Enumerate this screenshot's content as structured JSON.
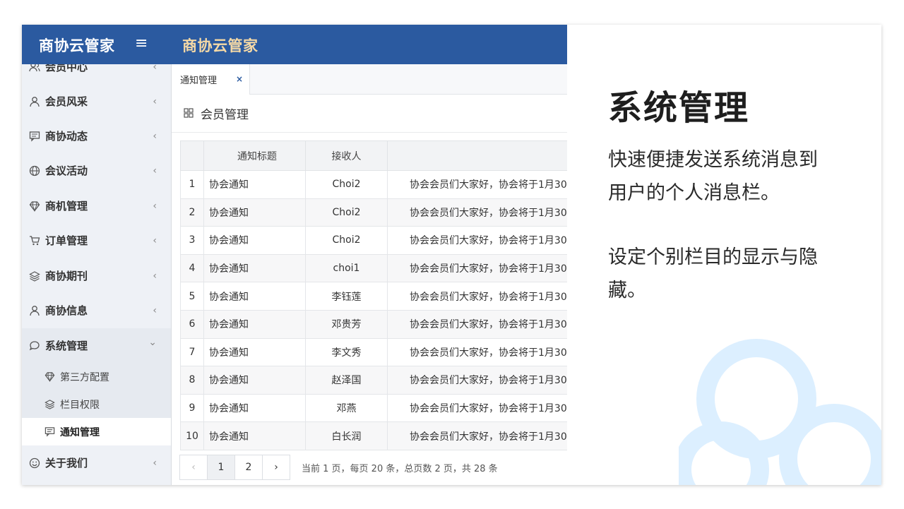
{
  "header": {
    "brand": "商协云管家",
    "menu_icon": "hamburger-icon",
    "title": "商协云管家"
  },
  "sidebar": {
    "items": [
      {
        "label": "会员中心",
        "icon": "user-group-icon"
      },
      {
        "label": "会员风采",
        "icon": "user-icon"
      },
      {
        "label": "商协动态",
        "icon": "message-icon"
      },
      {
        "label": "会议活动",
        "icon": "globe-icon"
      },
      {
        "label": "商机管理",
        "icon": "diamond-icon"
      },
      {
        "label": "订单管理",
        "icon": "cart-icon"
      },
      {
        "label": "商协期刊",
        "icon": "layers-icon"
      },
      {
        "label": "商协信息",
        "icon": "user-icon"
      },
      {
        "label": "系统管理",
        "icon": "chat-icon"
      },
      {
        "label": "关于我们",
        "icon": "smile-icon"
      }
    ],
    "subitems": [
      {
        "label": "第三方配置",
        "icon": "diamond-icon"
      },
      {
        "label": "栏目权限",
        "icon": "layers-icon"
      },
      {
        "label": "通知管理",
        "icon": "message-icon"
      }
    ],
    "chevron_collapsed": "‹",
    "chevron_expanded": "⌄"
  },
  "tabs": {
    "active_label": "通知管理",
    "close_glyph": "×"
  },
  "panel": {
    "title": "会员管理"
  },
  "table": {
    "headers": [
      "",
      "通知标题",
      "接收人",
      ""
    ],
    "rows": [
      {
        "no": "1",
        "title": "协会通知",
        "receiver": "Choi2",
        "content": "协会会员们大家好，协会将于1月30"
      },
      {
        "no": "2",
        "title": "协会通知",
        "receiver": "Choi2",
        "content": "协会会员们大家好，协会将于1月30"
      },
      {
        "no": "3",
        "title": "协会通知",
        "receiver": "Choi2",
        "content": "协会会员们大家好，协会将于1月30"
      },
      {
        "no": "4",
        "title": "协会通知",
        "receiver": "choi1",
        "content": "协会会员们大家好，协会将于1月30"
      },
      {
        "no": "5",
        "title": "协会通知",
        "receiver": "李钰莲",
        "content": "协会会员们大家好，协会将于1月30"
      },
      {
        "no": "6",
        "title": "协会通知",
        "receiver": "邓贵芳",
        "content": "协会会员们大家好，协会将于1月30"
      },
      {
        "no": "7",
        "title": "协会通知",
        "receiver": "李文秀",
        "content": "协会会员们大家好，协会将于1月30"
      },
      {
        "no": "8",
        "title": "协会通知",
        "receiver": "赵泽国",
        "content": "协会会员们大家好，协会将于1月30"
      },
      {
        "no": "9",
        "title": "协会通知",
        "receiver": "邓燕",
        "content": "协会会员们大家好，协会将于1月30"
      },
      {
        "no": "10",
        "title": "协会通知",
        "receiver": "白长润",
        "content": "协会会员们大家好，协会将于1月30"
      }
    ]
  },
  "pager": {
    "prev": "‹",
    "pages": [
      "1",
      "2"
    ],
    "next": "›",
    "info": "当前  1  页，每页  20  条，总页数 2 页，共 28 条"
  },
  "promo": {
    "title": "系统管理",
    "p1": "快速便捷发送系统消息到用户的个人消息栏。",
    "p2": "设定个别栏目的显示与隐藏。"
  },
  "colors": {
    "header_bg": "#2b5aa0",
    "header_title": "#f5d9a6",
    "sidebar_bg": "#eef1f6",
    "cloud": "#dcefff"
  }
}
